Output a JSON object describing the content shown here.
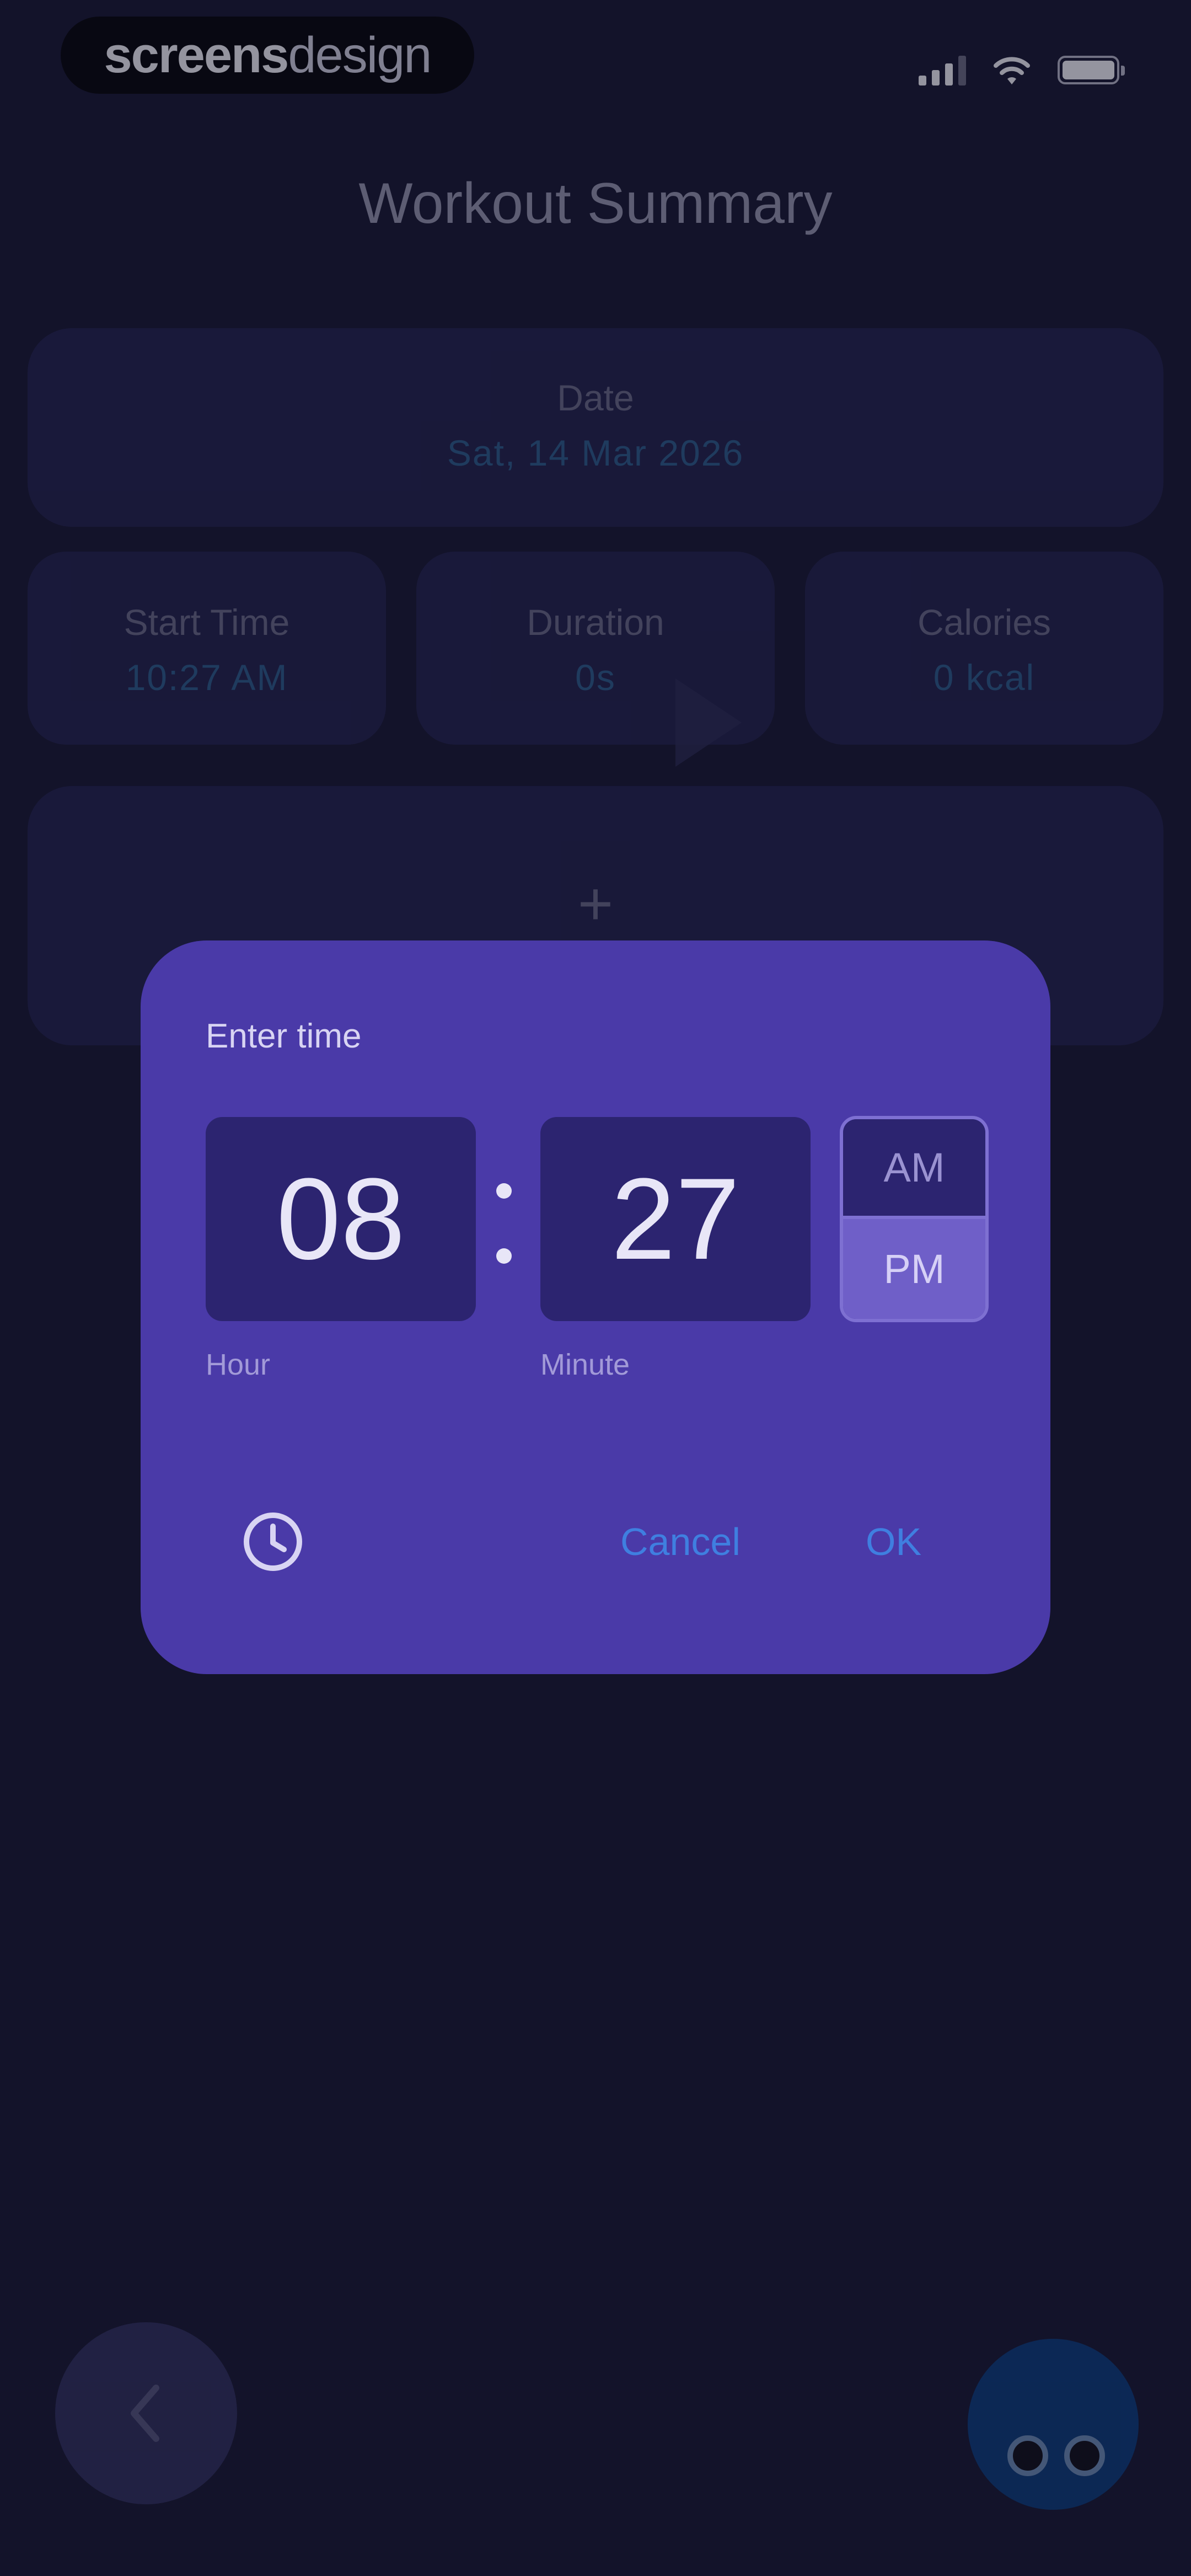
{
  "status_bar": {
    "brand_bold": "screens",
    "brand_light": "design"
  },
  "header": {
    "title": "Workout Summary"
  },
  "summary": {
    "date_label": "Date",
    "date_value": "Sat, 14 Mar 2026",
    "start_label": "Start Time",
    "start_value": "10:27 AM",
    "duration_label": "Duration",
    "duration_value": "0s",
    "calories_label": "Calories",
    "calories_value": "0 kcal",
    "add_symbol": "+"
  },
  "dialog": {
    "title": "Enter time",
    "hour": "08",
    "minute": "27",
    "hour_caption": "Hour",
    "minute_caption": "Minute",
    "am_label": "AM",
    "pm_label": "PM",
    "selected_period": "PM",
    "cancel_label": "Cancel",
    "ok_label": "OK",
    "mode_icon": "clock-icon"
  },
  "nav": {
    "back_icon": "chevron-left-icon",
    "assistant_icon": "mascot-icon"
  },
  "colors": {
    "background": "#13132a",
    "card": "#1f1f47",
    "dialog": "#4a3aa8",
    "accent": "#3f7fe0",
    "time_box": "#2c2470",
    "selected_period": "#6f5fc8"
  }
}
